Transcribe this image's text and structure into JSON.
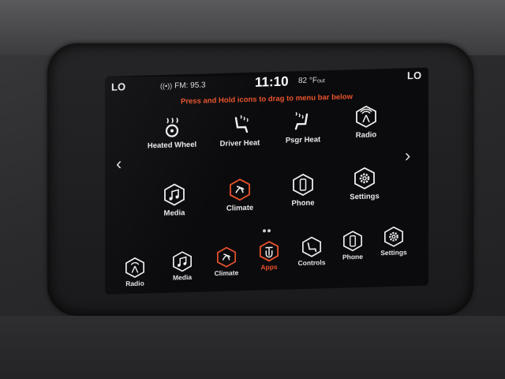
{
  "status": {
    "left_indicator": "LO",
    "right_indicator": "LO",
    "radio": "FM: 95.3",
    "clock": "11:10",
    "temperature": "82 °F",
    "temperature_suffix": "out"
  },
  "hint": "Press and Hold icons to drag to menu bar below",
  "apps_page": {
    "row1": [
      {
        "label": "Heated Wheel",
        "icon": "heated-wheel-icon"
      },
      {
        "label": "Driver Heat",
        "icon": "driver-seat-heat-icon"
      },
      {
        "label": "Psgr Heat",
        "icon": "passenger-seat-heat-icon"
      },
      {
        "label": "Radio",
        "icon": "radio-icon"
      }
    ],
    "row2": [
      {
        "label": "Media",
        "icon": "media-icon"
      },
      {
        "label": "Climate",
        "icon": "climate-icon"
      },
      {
        "label": "Phone",
        "icon": "phone-icon"
      },
      {
        "label": "Settings",
        "icon": "settings-icon"
      }
    ]
  },
  "menu_bar": [
    {
      "label": "Radio",
      "icon": "radio-icon"
    },
    {
      "label": "Media",
      "icon": "media-icon"
    },
    {
      "label": "Climate",
      "icon": "climate-icon"
    },
    {
      "label": "Apps",
      "icon": "apps-icon",
      "active": true
    },
    {
      "label": "Controls",
      "icon": "controls-icon"
    },
    {
      "label": "Phone",
      "icon": "phone-icon"
    },
    {
      "label": "Settings",
      "icon": "settings-icon"
    }
  ],
  "colors": {
    "accent": "#e8522a",
    "text": "#e9e9e9",
    "screen": "#0b0b0e"
  }
}
